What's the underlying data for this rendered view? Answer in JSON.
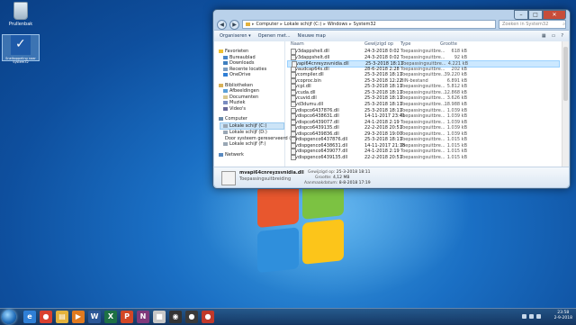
{
  "desktop": {
    "icons": [
      {
        "label": "Prullenbak",
        "icon": "recycle-bin-icon"
      },
      {
        "label": "Snelkoppeling naar System32",
        "icon": "shortcut-icon"
      }
    ]
  },
  "explorer": {
    "breadcrumb": [
      "Computer",
      "Lokale schijf (C:)",
      "Windows",
      "System32"
    ],
    "search_placeholder": "Zoeken in System32",
    "toolbar": {
      "organize": "Organiseren ▾",
      "open_with": "Openen met...",
      "new_folder": "Nieuwe map"
    },
    "nav": {
      "favorites": {
        "label": "Favorieten",
        "items": [
          "Bureaublad",
          "Downloads",
          "Recente locaties",
          "OneDrive"
        ]
      },
      "libraries": {
        "label": "Bibliotheken",
        "items": [
          "Afbeeldingen",
          "Documenten",
          "Muziek",
          "Video's"
        ]
      },
      "computer": {
        "label": "Computer",
        "items": [
          "Lokale schijf (C:)",
          "Lokale schijf (D:)",
          "Door systeem gereserveerd (E:)",
          "Lokale schijf (F:)"
        ]
      },
      "network": {
        "label": "Netwerk"
      }
    },
    "columns": {
      "name": "Naam",
      "date": "Gewijzigd op",
      "type": "Type",
      "size": "Grootte"
    },
    "files": [
      {
        "name": "mv3dappshell.dll",
        "date": "24-3-2018 0:02",
        "type": "Toepassingsuitbre...",
        "size": "618 kB"
      },
      {
        "name": "mv3dappshelt.dll",
        "date": "24-3-2018 0:02",
        "type": "Toepassingsuitbre...",
        "size": "92 kB"
      },
      {
        "name": "mvapi64cnreyzsvnidia.dll",
        "date": "25-3-2018 18:11",
        "type": "Toepassingsuitbre...",
        "size": "4.221 kB"
      },
      {
        "name": "mvaudcap64s.dll",
        "date": "28-6-2018 2:28",
        "type": "Toepassingsuitbre...",
        "size": "202 kB"
      },
      {
        "name": "mvcompiler.dll",
        "date": "25-3-2018 18:11",
        "type": "Toepassingsuitbre...",
        "size": "39.220 kB"
      },
      {
        "name": "mvcoproc.bin",
        "date": "25-3-2018 12:22",
        "type": "BIN-bestand",
        "size": "6.891 kB"
      },
      {
        "name": "mvcpl.dll",
        "date": "25-3-2018 18:11",
        "type": "Toepassingsuitbre...",
        "size": "5.812 kB"
      },
      {
        "name": "mvcuda.dll",
        "date": "25-3-2018 18:11",
        "type": "Toepassingsuitbre...",
        "size": "12.868 kB"
      },
      {
        "name": "mvcuvid.dll",
        "date": "25-3-2018 18:11",
        "type": "Toepassingsuitbre...",
        "size": "3.626 kB"
      },
      {
        "name": "mvd3dumu.dll",
        "date": "25-3-2018 18:11",
        "type": "Toepassingsuitbre...",
        "size": "18.988 kB"
      },
      {
        "name": "mvdispco6437876.dll",
        "date": "25-3-2018 18:11",
        "type": "Toepassingsuitbre...",
        "size": "1.039 kB"
      },
      {
        "name": "mvdispco6438631.dll",
        "date": "14-11-2017 23:41",
        "type": "Toepassingsuitbre...",
        "size": "1.039 kB"
      },
      {
        "name": "mvdispco6439077.dll",
        "date": "24-1-2018 2:19",
        "type": "Toepassingsuitbre...",
        "size": "1.039 kB"
      },
      {
        "name": "mvdispco6439135.dll",
        "date": "22-2-2018 20:51",
        "type": "Toepassingsuitbre...",
        "size": "1.039 kB"
      },
      {
        "name": "mvdispco6439836.dll",
        "date": "29-3-2018 19:00",
        "type": "Toepassingsuitbre...",
        "size": "1.039 kB"
      },
      {
        "name": "mvdispgenco6437876.dll",
        "date": "25-3-2018 18:11",
        "type": "Toepassingsuitbre...",
        "size": "1.015 kB"
      },
      {
        "name": "mvdispgenco6438631.dll",
        "date": "14-11-2017 21:18",
        "type": "Toepassingsuitbre...",
        "size": "1.015 kB"
      },
      {
        "name": "mvdispgenco6439077.dll",
        "date": "24-1-2018 2:19",
        "type": "Toepassingsuitbre...",
        "size": "1.015 kB"
      },
      {
        "name": "mvdispgenco6439135.dll",
        "date": "22-2-2018 20:51",
        "type": "Toepassingsuitbre...",
        "size": "1.015 kB"
      }
    ],
    "selected_index": 2,
    "details": {
      "name": "mvapi64cnreyzsvnidia.dll",
      "type": "Toepassingsuitbreiding",
      "modified_label": "Gewijzigd op:",
      "modified": "25-3-2018 18:11",
      "size_label": "Grootte:",
      "size": "4,12 MB",
      "created_label": "Aanmaakdatum:",
      "created": "8-8-2018 17:19"
    }
  },
  "taskbar": {
    "apps": [
      {
        "icon": "internet-explorer-icon",
        "letter": "e",
        "color": "#2f7fd6"
      },
      {
        "icon": "chrome-icon",
        "letter": "●",
        "color": "#d9402f"
      },
      {
        "icon": "file-explorer-icon",
        "letter": "▤",
        "color": "#e3b23c"
      },
      {
        "icon": "media-player-icon",
        "letter": "▶",
        "color": "#e07a1f"
      },
      {
        "icon": "word-icon",
        "letter": "W",
        "color": "#2b5797"
      },
      {
        "icon": "excel-icon",
        "letter": "X",
        "color": "#1e7145"
      },
      {
        "icon": "powerpoint-icon",
        "letter": "P",
        "color": "#d24726"
      },
      {
        "icon": "onenote-icon",
        "letter": "N",
        "color": "#80397b"
      },
      {
        "icon": "sticky-app-icon",
        "letter": "■",
        "color": "#c8c8c8"
      },
      {
        "icon": "video-app-icon",
        "letter": "◉",
        "color": "#333333"
      },
      {
        "icon": "obs-icon",
        "letter": "●",
        "color": "#3a3a3a"
      },
      {
        "icon": "record-icon",
        "letter": "●",
        "color": "#c0392b"
      }
    ],
    "clock_time": "23:58",
    "clock_date": "2-9-2018"
  }
}
